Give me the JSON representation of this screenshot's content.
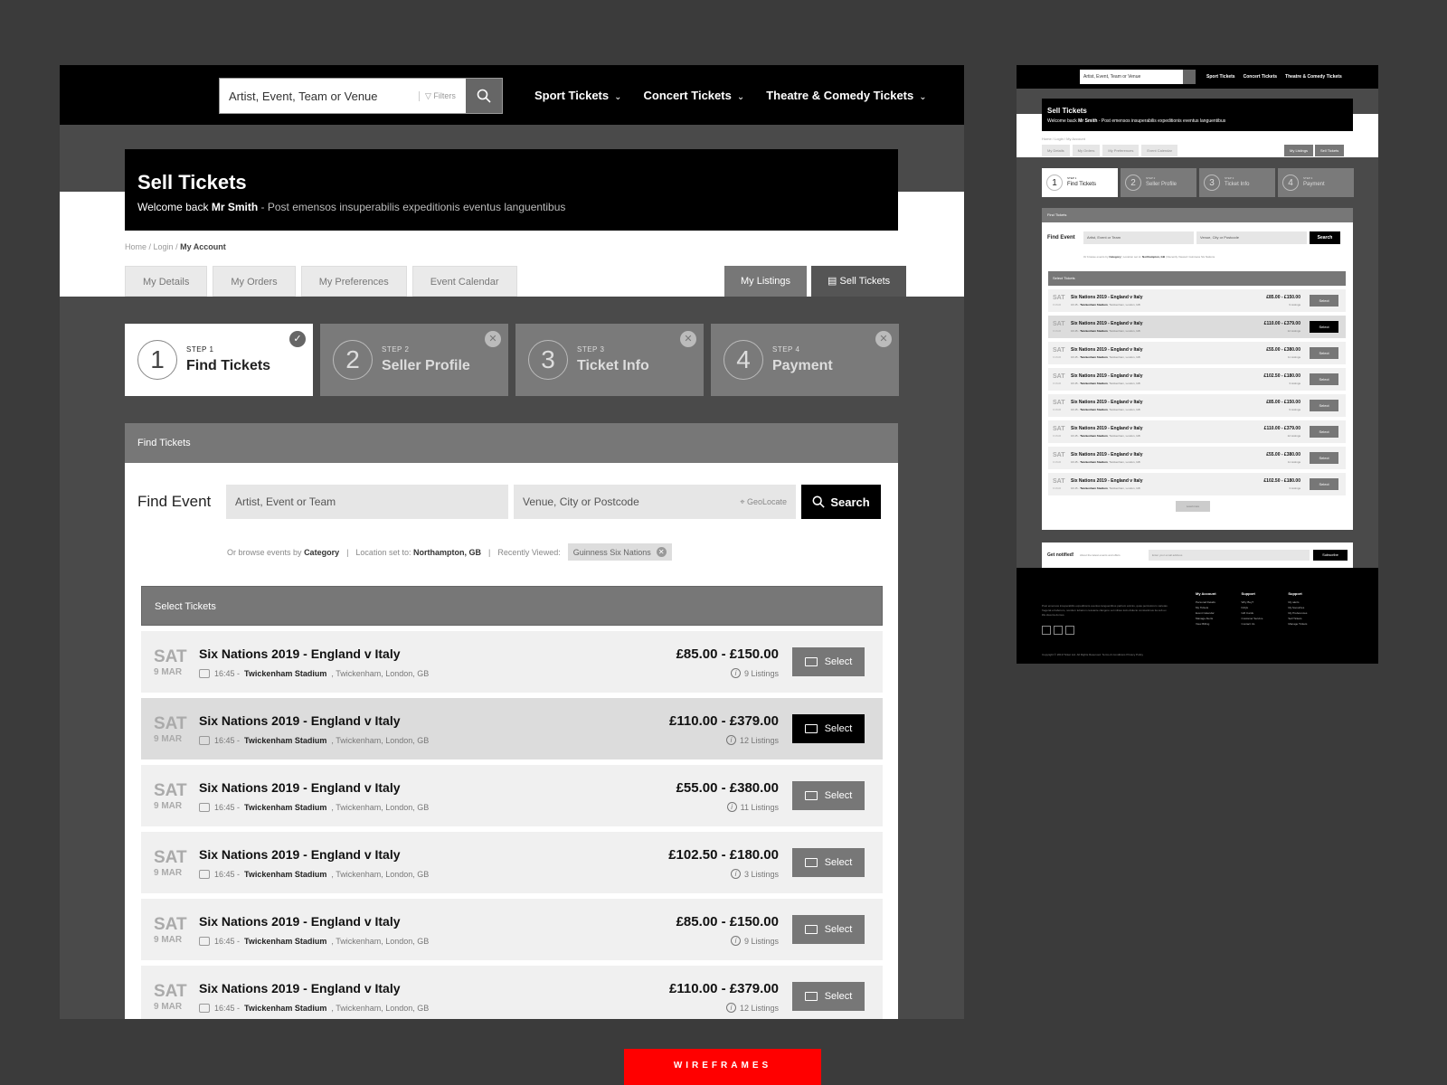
{
  "header": {
    "search_placeholder": "Artist, Event, Team or Venue",
    "filters_label": "Filters",
    "nav": [
      "Sport Tickets",
      "Concert Tickets",
      "Theatre & Comedy Tickets"
    ]
  },
  "hero": {
    "title": "Sell Tickets",
    "welcome_prefix": "Welcome back",
    "user_name": "Mr Smith",
    "tagline": "- Post emensos insuperabilis expeditionis eventus languentibus"
  },
  "breadcrumb": {
    "home": "Home",
    "login": "Login",
    "current": "My Account"
  },
  "tabs": [
    "My Details",
    "My Orders",
    "My Preferences",
    "Event Calendar"
  ],
  "right_tabs": {
    "listings": "My Listings",
    "sell": "Sell Tickets"
  },
  "steps": [
    {
      "num": "1",
      "sub": "STEP 1",
      "label": "Find Tickets"
    },
    {
      "num": "2",
      "sub": "STEP 2",
      "label": "Seller Profile"
    },
    {
      "num": "3",
      "sub": "STEP 3",
      "label": "Ticket Info"
    },
    {
      "num": "4",
      "sub": "STEP 4",
      "label": "Payment"
    }
  ],
  "find_panel": {
    "header": "Find Tickets",
    "find_event_label": "Find Event",
    "event_placeholder": "Artist, Event or Team",
    "venue_placeholder": "Venue, City or Postcode",
    "geolocate": "GeoLocate",
    "search_button": "Search",
    "browse_prefix": "Or browse events by",
    "browse_link": "Category",
    "location_prefix": "Location set to:",
    "location": "Northampton, GB",
    "recent_prefix": "Recently Viewed:",
    "recent_chip": "Guinness Six Nations",
    "select_header": "Select Tickets"
  },
  "events": [
    {
      "dow": "SAT",
      "date": "9 MAR",
      "name": "Six Nations 2019 - England v Italy",
      "time": "16:45 -",
      "venue": "Twickenham Stadium",
      "location": ", Twickenham, London, GB",
      "price": "£85.00 - £150.00",
      "listings": "9 Listings",
      "select": "Select"
    },
    {
      "dow": "SAT",
      "date": "9 MAR",
      "name": "Six Nations 2019 - England v Italy",
      "time": "16:45 -",
      "venue": "Twickenham Stadium",
      "location": ", Twickenham, London, GB",
      "price": "£110.00 - £379.00",
      "listings": "12 Listings",
      "select": "Select"
    },
    {
      "dow": "SAT",
      "date": "9 MAR",
      "name": "Six Nations 2019 - England v Italy",
      "time": "16:45 -",
      "venue": "Twickenham Stadium",
      "location": ", Twickenham, London, GB",
      "price": "£55.00 - £380.00",
      "listings": "11 Listings",
      "select": "Select"
    },
    {
      "dow": "SAT",
      "date": "9 MAR",
      "name": "Six Nations 2019 - England v Italy",
      "time": "16:45 -",
      "venue": "Twickenham Stadium",
      "location": ", Twickenham, London, GB",
      "price": "£102.50 - £180.00",
      "listings": "3 Listings",
      "select": "Select"
    },
    {
      "dow": "SAT",
      "date": "9 MAR",
      "name": "Six Nations 2019 - England v Italy",
      "time": "16:45 -",
      "venue": "Twickenham Stadium",
      "location": ", Twickenham, London, GB",
      "price": "£85.00 - £150.00",
      "listings": "9 Listings",
      "select": "Select"
    },
    {
      "dow": "SAT",
      "date": "9 MAR",
      "name": "Six Nations 2019 - England v Italy",
      "time": "16:45 -",
      "venue": "Twickenham Stadium",
      "location": ", Twickenham, London, GB",
      "price": "£110.00 - £379.00",
      "listings": "12 Listings",
      "select": "Select"
    }
  ],
  "mini": {
    "load_more": "Load more",
    "notify_title": "Get notified!",
    "notify_sub": "About the latest events and offers",
    "notify_input": "Enter your email address",
    "subscribe": "Subscribe",
    "footer_cols": [
      {
        "title": "My Account",
        "items": [
          "Personal Details",
          "My Tickets",
          "Event Calendar",
          "Manage Alerts",
          "View Billing"
        ]
      },
      {
        "title": "Support",
        "items": [
          "Why Buy?",
          "FAQs",
          "Gift Cards",
          "Customer Service",
          "Contact Us"
        ]
      },
      {
        "title": "Support",
        "items": [
          "My alerts",
          "My favourites",
          "My Preferences",
          "Sell Tickets",
          "Manage Tickets"
        ]
      }
    ],
    "footer_text": "Post emensos insuperabilis expeditionis eventus languentibus partium animis, quas periculorum varietas fregerat et laborum, nondum tubarum cessante clangore vel milites locis diducto constantinus ita sub ex illis idea ita domus.",
    "copyright": "Copyright © 2019 Ticket Ltd. All Rights Reserved. Terms & Conditions  Privacy Policy"
  },
  "badge": "WIREFRAMES",
  "colors": {
    "accent": "#ff0000",
    "nav": "#000000",
    "panel": "#777777"
  }
}
